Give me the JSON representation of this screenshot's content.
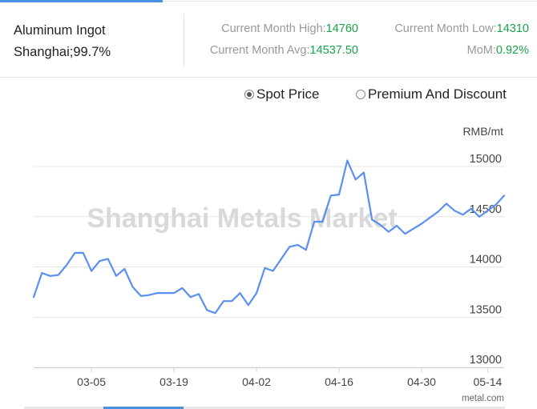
{
  "product": {
    "name": "Aluminum Ingot",
    "spec": "Shanghai;99.7%"
  },
  "stats": {
    "high_label": "Current Month High:",
    "high_value": "14760",
    "low_label": "Current Month Low:",
    "low_value": "14310",
    "avg_label": "Current Month Avg:",
    "avg_value": "14537.50",
    "mom_label": "MoM:",
    "mom_value": "0.92%"
  },
  "options": {
    "spot": "Spot Price",
    "premium": "Premium And Discount",
    "selected": "spot"
  },
  "chart_data": {
    "type": "line",
    "ylabel": "RMB/mt",
    "ylim": [
      13000,
      15250
    ],
    "yticks": [
      13000,
      13500,
      14000,
      14500,
      15000
    ],
    "xticks": [
      {
        "label": "03-05",
        "i": 7
      },
      {
        "label": "03-19",
        "i": 17
      },
      {
        "label": "04-02",
        "i": 27
      },
      {
        "label": "04-16",
        "i": 37
      },
      {
        "label": "04-30",
        "i": 47
      },
      {
        "label": "05-14",
        "i": 55
      }
    ],
    "n_points": 58,
    "grid": true,
    "watermark": "Shanghai Metals Market",
    "source": "metal.com",
    "color": "#5b8ff0",
    "series": [
      {
        "values": [
          13700,
          13940,
          13910,
          13920,
          14020,
          14140,
          14140,
          13960,
          14060,
          14080,
          13910,
          13980,
          13800,
          13710,
          13720,
          13740,
          13740,
          13740,
          13790,
          13700,
          13730,
          13570,
          13540,
          13660,
          13660,
          13740,
          13620,
          13740,
          13990,
          13960,
          14080,
          14200,
          14220,
          14170,
          14450,
          14450,
          14710,
          14720,
          15060,
          14870,
          14940,
          14470,
          14420,
          14350,
          14410,
          14330,
          14380,
          14430,
          14490,
          14550,
          14630,
          14560,
          14520,
          14580,
          14500,
          14560,
          14620,
          14710
        ]
      }
    ]
  }
}
